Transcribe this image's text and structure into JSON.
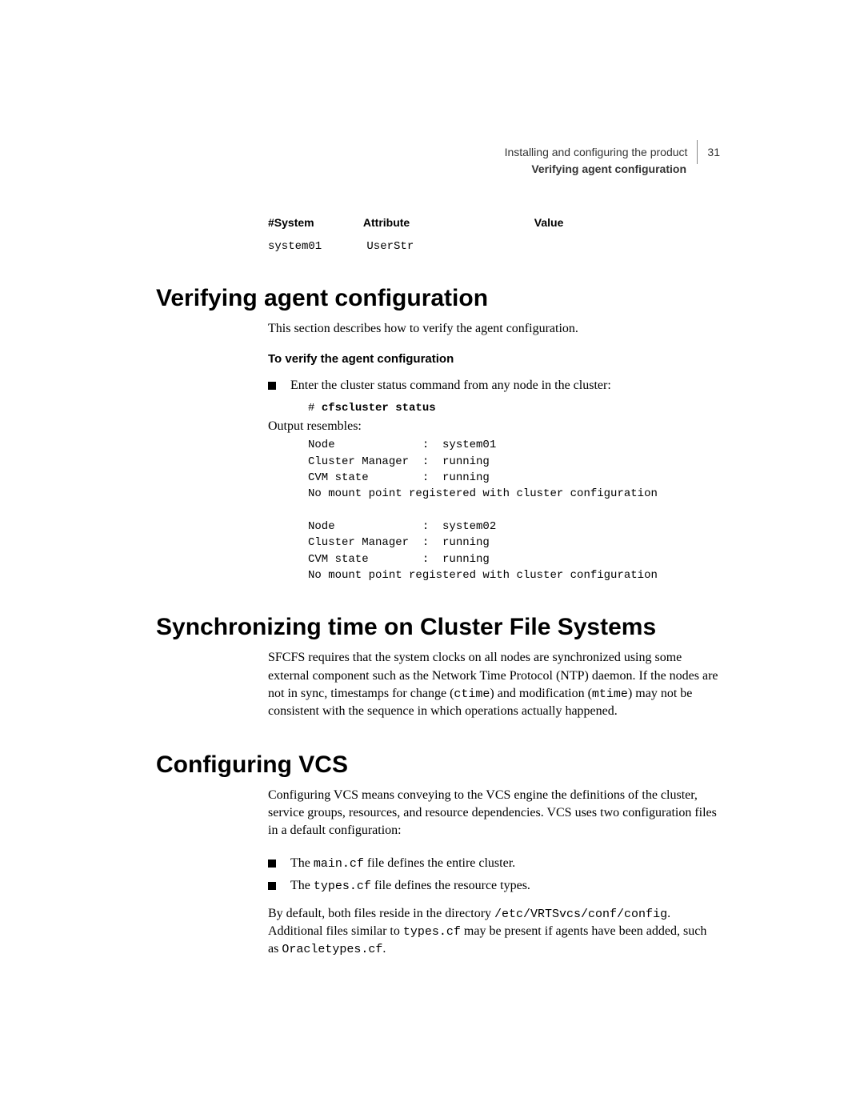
{
  "header": {
    "chapter": "Installing and configuring the product",
    "page_number": "31",
    "section": "Verifying agent configuration"
  },
  "table": {
    "headers": {
      "c1": "#System",
      "c2": "Attribute",
      "c3": "Value"
    },
    "row": {
      "c1": "system01",
      "c2": "UserStr",
      "c3": ""
    }
  },
  "s1": {
    "heading": "Verifying agent configuration",
    "intro": "This section describes how to verify the agent configuration.",
    "subhead": "To verify the agent configuration",
    "bullet": "Enter the cluster status command from any node in the cluster:",
    "cmd_prompt": "# ",
    "cmd": "cfscluster status",
    "resembles": "Output resembles:",
    "output": "Node             :  system01\nCluster Manager  :  running\nCVM state        :  running\nNo mount point registered with cluster configuration\n\nNode             :  system02\nCluster Manager  :  running\nCVM state        :  running\nNo mount point registered with cluster configuration"
  },
  "s2": {
    "heading": "Synchronizing time on Cluster File Systems",
    "p_a": "SFCFS requires that the system clocks on all nodes are synchronized using some external component such as the Network Time Protocol (NTP) daemon. If the nodes are not in sync, timestamps for change (",
    "p_code1": "ctime",
    "p_b": ") and modification (",
    "p_code2": "mtime",
    "p_c": ") may not be consistent with the sequence in which operations actually happened."
  },
  "s3": {
    "heading": "Configuring VCS",
    "p1": "Configuring VCS means conveying to the VCS engine the definitions of the cluster, service groups, resources, and resource dependencies. VCS uses two configuration files in a default configuration:",
    "b1_a": "The ",
    "b1_code": "main.cf",
    "b1_b": " file defines the entire cluster.",
    "b2_a": "The ",
    "b2_code": "types.cf",
    "b2_b": " file defines the resource types.",
    "p2_a": "By default, both files reside in the directory ",
    "p2_code1": "/etc/VRTSvcs/conf/config",
    "p2_b": ". Additional files similar to ",
    "p2_code2": "types.cf",
    "p2_c": " may be present if agents have been added, such as ",
    "p2_code3": "Oracletypes.cf",
    "p2_d": "."
  }
}
